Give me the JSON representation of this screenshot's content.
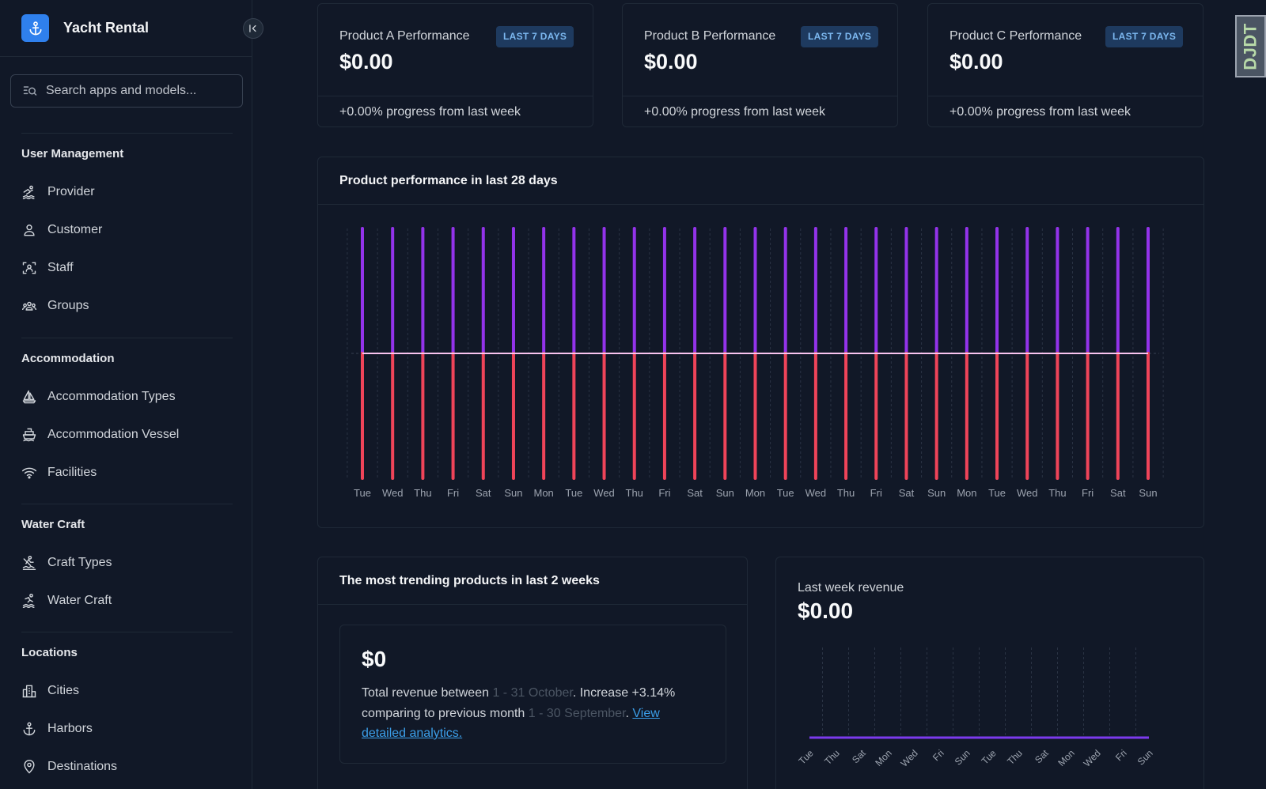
{
  "sidebar": {
    "brand": "Yacht Rental",
    "search_placeholder": "Search apps and models...",
    "sections": [
      {
        "title": "User Management",
        "items": [
          {
            "label": "Provider",
            "icon": "swimmer-icon"
          },
          {
            "label": "Customer",
            "icon": "person-icon"
          },
          {
            "label": "Staff",
            "icon": "id-badge-icon"
          },
          {
            "label": "Groups",
            "icon": "groups-icon"
          }
        ]
      },
      {
        "title": "Accommodation",
        "items": [
          {
            "label": "Accommodation Types",
            "icon": "sailboat-icon"
          },
          {
            "label": "Accommodation Vessel",
            "icon": "ship-icon"
          },
          {
            "label": "Facilities",
            "icon": "wifi-icon"
          }
        ]
      },
      {
        "title": "Water Craft",
        "items": [
          {
            "label": "Craft Types",
            "icon": "rowing-icon"
          },
          {
            "label": "Water Craft",
            "icon": "surfer-icon"
          }
        ]
      },
      {
        "title": "Locations",
        "items": [
          {
            "label": "Cities",
            "icon": "city-icon"
          },
          {
            "label": "Harbors",
            "icon": "anchor-icon"
          },
          {
            "label": "Destinations",
            "icon": "pin-icon"
          }
        ]
      }
    ]
  },
  "cards": [
    {
      "title": "Product A Performance",
      "badge": "LAST 7 DAYS",
      "value": "$0.00",
      "footer": "+0.00% progress from last week"
    },
    {
      "title": "Product B Performance",
      "badge": "LAST 7 DAYS",
      "value": "$0.00",
      "footer": "+0.00% progress from last week"
    },
    {
      "title": "Product C Performance",
      "badge": "LAST 7 DAYS",
      "value": "$0.00",
      "footer": "+0.00% progress from last week"
    }
  ],
  "chart": {
    "title": "Product performance in last 28 days"
  },
  "trending": {
    "title": "The most trending products in last 2 weeks",
    "amount": "$0",
    "text1": "Total revenue between ",
    "range1": "1 - 31 October",
    "text2": ". Increase +3.14% comparing to previous month ",
    "range2": "1 - 30 September",
    "text3": ". ",
    "link": "View detailed analytics."
  },
  "revenue": {
    "label": "Last week revenue",
    "value": "$0.00"
  },
  "debug_toolbar": {
    "label": "DJDT"
  },
  "colors": {
    "positive": "#9333ea",
    "negative": "#ef4459",
    "baseline": "#f9c4f0",
    "revenue_line": "#7c3aed"
  },
  "chart_data": [
    {
      "type": "bar",
      "categories": [
        "Tue",
        "Wed",
        "Thu",
        "Fri",
        "Sat",
        "Sun",
        "Mon",
        "Tue",
        "Wed",
        "Thu",
        "Fri",
        "Sat",
        "Sun",
        "Mon",
        "Tue",
        "Wed",
        "Thu",
        "Fri",
        "Sat",
        "Sun",
        "Mon",
        "Tue",
        "Wed",
        "Thu",
        "Fri",
        "Sat",
        "Sun"
      ],
      "series": [
        {
          "values": [
            1,
            1,
            1,
            1,
            1,
            1,
            1,
            1,
            1,
            1,
            1,
            1,
            1,
            1,
            1,
            1,
            1,
            1,
            1,
            1,
            1,
            1,
            1,
            1,
            1,
            1,
            1
          ]
        },
        {
          "values": [
            -1,
            -1,
            -1,
            -1,
            -1,
            -1,
            -1,
            -1,
            -1,
            -1,
            -1,
            -1,
            -1,
            -1,
            -1,
            -1,
            -1,
            -1,
            -1,
            -1,
            -1,
            -1,
            -1,
            -1,
            -1,
            -1,
            -1
          ]
        },
        {
          "values": [
            0,
            0,
            0,
            0,
            0,
            0,
            0,
            0,
            0,
            0,
            0,
            0,
            0,
            0,
            0,
            0,
            0,
            0,
            0,
            0,
            0,
            0,
            0,
            0,
            0,
            0,
            0
          ]
        }
      ],
      "ylim": [
        -1,
        1
      ],
      "grid": true,
      "title": "Product performance in last 28 days"
    },
    {
      "type": "line",
      "categories": [
        "Tue",
        "Thu",
        "Sat",
        "Mon",
        "Wed",
        "Fri",
        "Sun",
        "Tue",
        "Thu",
        "Sat",
        "Mon",
        "Wed",
        "Fri",
        "Sun"
      ],
      "series": [
        {
          "values": [
            0,
            0,
            0,
            0,
            0,
            0,
            0,
            0,
            0,
            0,
            0,
            0,
            0,
            0
          ]
        }
      ],
      "grid": true,
      "title": ""
    }
  ]
}
